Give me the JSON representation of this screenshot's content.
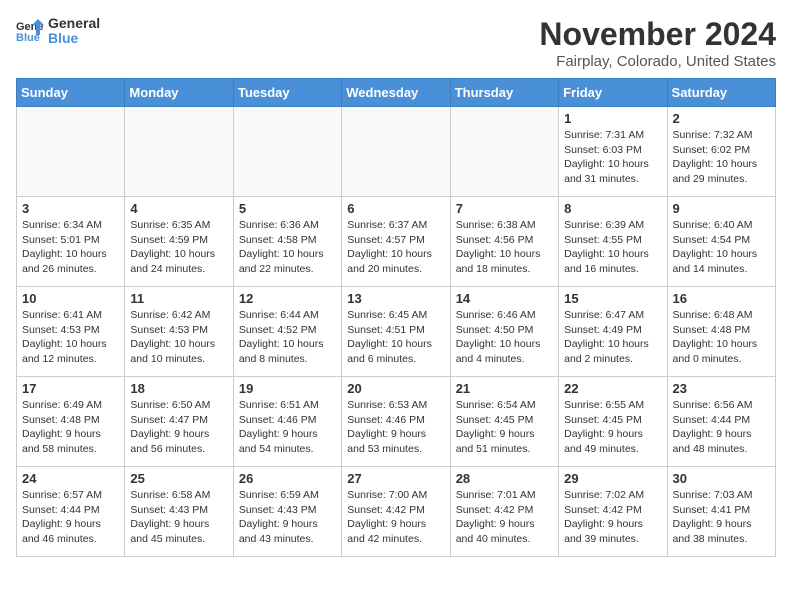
{
  "header": {
    "logo_general": "General",
    "logo_blue": "Blue",
    "month_title": "November 2024",
    "location": "Fairplay, Colorado, United States"
  },
  "weekdays": [
    "Sunday",
    "Monday",
    "Tuesday",
    "Wednesday",
    "Thursday",
    "Friday",
    "Saturday"
  ],
  "weeks": [
    [
      {
        "day": "",
        "sunrise": "",
        "sunset": "",
        "daylight": ""
      },
      {
        "day": "",
        "sunrise": "",
        "sunset": "",
        "daylight": ""
      },
      {
        "day": "",
        "sunrise": "",
        "sunset": "",
        "daylight": ""
      },
      {
        "day": "",
        "sunrise": "",
        "sunset": "",
        "daylight": ""
      },
      {
        "day": "",
        "sunrise": "",
        "sunset": "",
        "daylight": ""
      },
      {
        "day": "1",
        "sunrise": "Sunrise: 7:31 AM",
        "sunset": "Sunset: 6:03 PM",
        "daylight": "Daylight: 10 hours and 31 minutes."
      },
      {
        "day": "2",
        "sunrise": "Sunrise: 7:32 AM",
        "sunset": "Sunset: 6:02 PM",
        "daylight": "Daylight: 10 hours and 29 minutes."
      }
    ],
    [
      {
        "day": "3",
        "sunrise": "Sunrise: 6:34 AM",
        "sunset": "Sunset: 5:01 PM",
        "daylight": "Daylight: 10 hours and 26 minutes."
      },
      {
        "day": "4",
        "sunrise": "Sunrise: 6:35 AM",
        "sunset": "Sunset: 4:59 PM",
        "daylight": "Daylight: 10 hours and 24 minutes."
      },
      {
        "day": "5",
        "sunrise": "Sunrise: 6:36 AM",
        "sunset": "Sunset: 4:58 PM",
        "daylight": "Daylight: 10 hours and 22 minutes."
      },
      {
        "day": "6",
        "sunrise": "Sunrise: 6:37 AM",
        "sunset": "Sunset: 4:57 PM",
        "daylight": "Daylight: 10 hours and 20 minutes."
      },
      {
        "day": "7",
        "sunrise": "Sunrise: 6:38 AM",
        "sunset": "Sunset: 4:56 PM",
        "daylight": "Daylight: 10 hours and 18 minutes."
      },
      {
        "day": "8",
        "sunrise": "Sunrise: 6:39 AM",
        "sunset": "Sunset: 4:55 PM",
        "daylight": "Daylight: 10 hours and 16 minutes."
      },
      {
        "day": "9",
        "sunrise": "Sunrise: 6:40 AM",
        "sunset": "Sunset: 4:54 PM",
        "daylight": "Daylight: 10 hours and 14 minutes."
      }
    ],
    [
      {
        "day": "10",
        "sunrise": "Sunrise: 6:41 AM",
        "sunset": "Sunset: 4:53 PM",
        "daylight": "Daylight: 10 hours and 12 minutes."
      },
      {
        "day": "11",
        "sunrise": "Sunrise: 6:42 AM",
        "sunset": "Sunset: 4:53 PM",
        "daylight": "Daylight: 10 hours and 10 minutes."
      },
      {
        "day": "12",
        "sunrise": "Sunrise: 6:44 AM",
        "sunset": "Sunset: 4:52 PM",
        "daylight": "Daylight: 10 hours and 8 minutes."
      },
      {
        "day": "13",
        "sunrise": "Sunrise: 6:45 AM",
        "sunset": "Sunset: 4:51 PM",
        "daylight": "Daylight: 10 hours and 6 minutes."
      },
      {
        "day": "14",
        "sunrise": "Sunrise: 6:46 AM",
        "sunset": "Sunset: 4:50 PM",
        "daylight": "Daylight: 10 hours and 4 minutes."
      },
      {
        "day": "15",
        "sunrise": "Sunrise: 6:47 AM",
        "sunset": "Sunset: 4:49 PM",
        "daylight": "Daylight: 10 hours and 2 minutes."
      },
      {
        "day": "16",
        "sunrise": "Sunrise: 6:48 AM",
        "sunset": "Sunset: 4:48 PM",
        "daylight": "Daylight: 10 hours and 0 minutes."
      }
    ],
    [
      {
        "day": "17",
        "sunrise": "Sunrise: 6:49 AM",
        "sunset": "Sunset: 4:48 PM",
        "daylight": "Daylight: 9 hours and 58 minutes."
      },
      {
        "day": "18",
        "sunrise": "Sunrise: 6:50 AM",
        "sunset": "Sunset: 4:47 PM",
        "daylight": "Daylight: 9 hours and 56 minutes."
      },
      {
        "day": "19",
        "sunrise": "Sunrise: 6:51 AM",
        "sunset": "Sunset: 4:46 PM",
        "daylight": "Daylight: 9 hours and 54 minutes."
      },
      {
        "day": "20",
        "sunrise": "Sunrise: 6:53 AM",
        "sunset": "Sunset: 4:46 PM",
        "daylight": "Daylight: 9 hours and 53 minutes."
      },
      {
        "day": "21",
        "sunrise": "Sunrise: 6:54 AM",
        "sunset": "Sunset: 4:45 PM",
        "daylight": "Daylight: 9 hours and 51 minutes."
      },
      {
        "day": "22",
        "sunrise": "Sunrise: 6:55 AM",
        "sunset": "Sunset: 4:45 PM",
        "daylight": "Daylight: 9 hours and 49 minutes."
      },
      {
        "day": "23",
        "sunrise": "Sunrise: 6:56 AM",
        "sunset": "Sunset: 4:44 PM",
        "daylight": "Daylight: 9 hours and 48 minutes."
      }
    ],
    [
      {
        "day": "24",
        "sunrise": "Sunrise: 6:57 AM",
        "sunset": "Sunset: 4:44 PM",
        "daylight": "Daylight: 9 hours and 46 minutes."
      },
      {
        "day": "25",
        "sunrise": "Sunrise: 6:58 AM",
        "sunset": "Sunset: 4:43 PM",
        "daylight": "Daylight: 9 hours and 45 minutes."
      },
      {
        "day": "26",
        "sunrise": "Sunrise: 6:59 AM",
        "sunset": "Sunset: 4:43 PM",
        "daylight": "Daylight: 9 hours and 43 minutes."
      },
      {
        "day": "27",
        "sunrise": "Sunrise: 7:00 AM",
        "sunset": "Sunset: 4:42 PM",
        "daylight": "Daylight: 9 hours and 42 minutes."
      },
      {
        "day": "28",
        "sunrise": "Sunrise: 7:01 AM",
        "sunset": "Sunset: 4:42 PM",
        "daylight": "Daylight: 9 hours and 40 minutes."
      },
      {
        "day": "29",
        "sunrise": "Sunrise: 7:02 AM",
        "sunset": "Sunset: 4:42 PM",
        "daylight": "Daylight: 9 hours and 39 minutes."
      },
      {
        "day": "30",
        "sunrise": "Sunrise: 7:03 AM",
        "sunset": "Sunset: 4:41 PM",
        "daylight": "Daylight: 9 hours and 38 minutes."
      }
    ]
  ]
}
